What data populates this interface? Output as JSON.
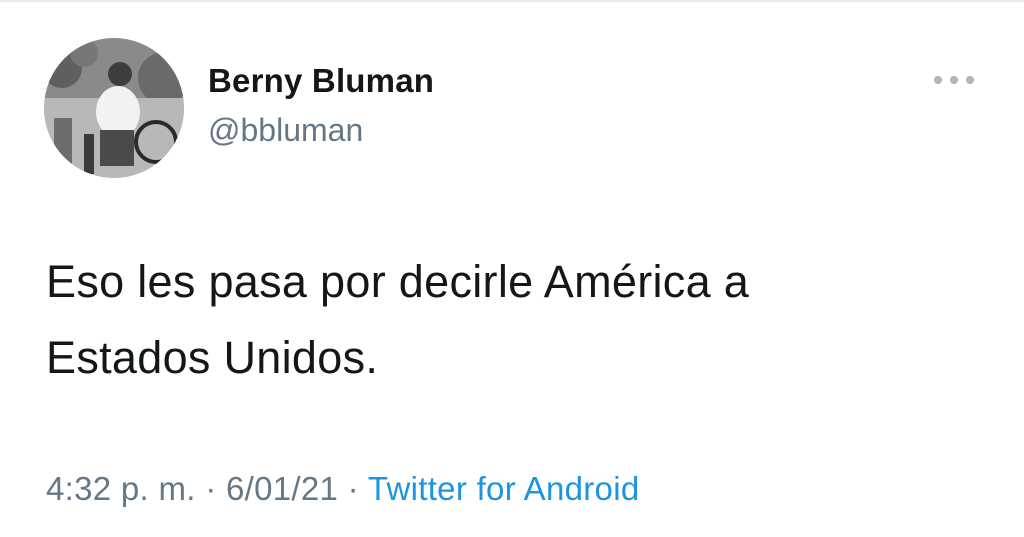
{
  "author": {
    "display_name": "Berny Bluman",
    "handle": "@bbluman",
    "avatar_icon": "profile-photo"
  },
  "tweet": {
    "text_lines": [
      "Eso les pasa por decirle América a",
      "Estados Unidos."
    ]
  },
  "meta": {
    "time": "4:32 p. m.",
    "separator": "·",
    "date": "6/01/21",
    "source": "Twitter for Android"
  },
  "menu": {
    "icon": "more-options-icon"
  },
  "colors": {
    "name": "#14171a",
    "secondary": "#657786",
    "link": "#1b95e0",
    "background": "#ffffff"
  }
}
